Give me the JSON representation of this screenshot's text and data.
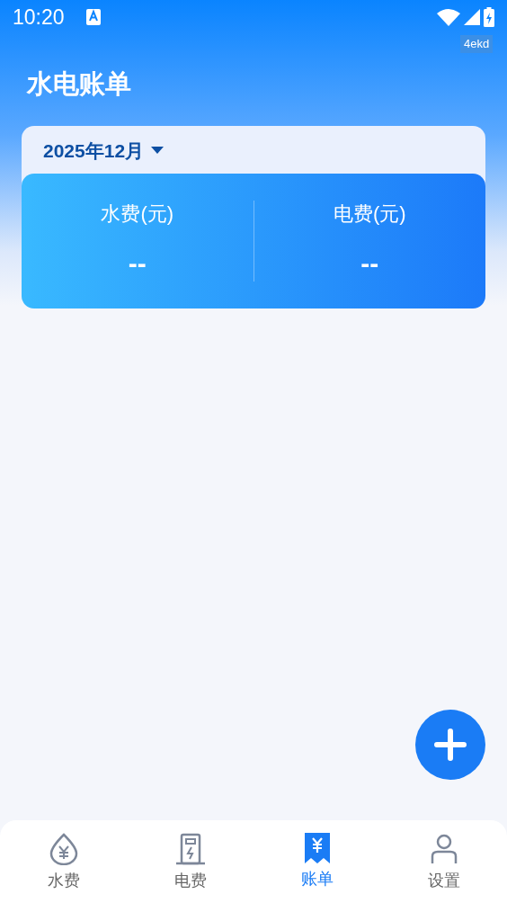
{
  "status_bar": {
    "time": "10:20",
    "tag": "4ekd"
  },
  "title": "水电账单",
  "period": {
    "label": "2025年12月"
  },
  "summary": [
    {
      "label": "水费(元)",
      "value": "--"
    },
    {
      "label": "电费(元)",
      "value": "--"
    }
  ],
  "tabs": [
    {
      "kind": "water",
      "label": "水费",
      "selected": false
    },
    {
      "kind": "power",
      "label": "电费",
      "selected": false
    },
    {
      "kind": "bill",
      "label": "账单",
      "selected": true
    },
    {
      "kind": "person",
      "label": "设置",
      "selected": false
    }
  ]
}
